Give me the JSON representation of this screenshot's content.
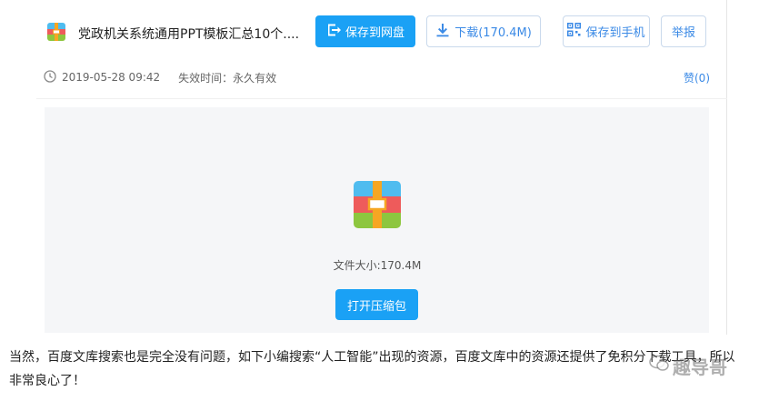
{
  "file": {
    "title": "党政机关系统通用PPT模板汇总10个...."
  },
  "buttons": {
    "save_to_cloud": "保存到网盘",
    "download": "下载(170.4M)",
    "save_to_phone": "保存到手机",
    "report": "举报"
  },
  "meta": {
    "date": "2019-05-28 09:42",
    "expire": "失效时间：永久有效",
    "like": "赞(0)"
  },
  "preview": {
    "size": "文件大小:170.4M",
    "open_button": "打开压缩包"
  },
  "article": {
    "text": "当然，百度文库搜索也是完全没有问题，如下小编搜索“人工智能”出现的资源，百度文库中的资源还提供了免积分下载工具，所以非常良心了！"
  },
  "watermark": {
    "text": "趣导哥"
  },
  "colors": {
    "primary": "#1aa1f5",
    "link": "#3b8ae6",
    "preview_bg": "#f5f6f8",
    "icon_top": "#4fbcef",
    "icon_mid": "#ee5b5b",
    "icon_bottom": "#8dc63f",
    "icon_strap": "#f6a623"
  },
  "icons": [
    "zip-file-icon",
    "save-cloud-icon",
    "download-icon",
    "qr-code-icon",
    "clock-icon"
  ]
}
